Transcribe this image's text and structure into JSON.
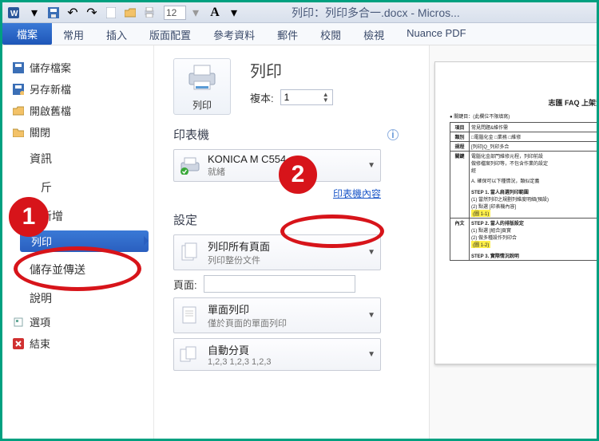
{
  "titlebar": {
    "font_size": "12",
    "title": "列印：列印多合一.docx - Micros..."
  },
  "ribbon": {
    "file_tab": "檔案",
    "tabs": [
      "常用",
      "插入",
      "版面配置",
      "參考資料",
      "郵件",
      "校閱",
      "檢視",
      "Nuance PDF"
    ]
  },
  "leftmenu": {
    "save": "儲存檔案",
    "save_as": "另存新檔",
    "open": "開啟舊檔",
    "close": "關閉",
    "info": "資訊",
    "recent_trunc": "斤",
    "new": "新增",
    "print": "列印",
    "save_send": "儲存並傳送",
    "help": "說明",
    "options": "選項",
    "exit": "結束"
  },
  "annotations": {
    "badge1": "1",
    "badge2": "2"
  },
  "print": {
    "heading": "列印",
    "print_btn": "列印",
    "copies_label": "複本:",
    "copies_value": "1",
    "printer_heading": "印表機",
    "printer_name": "KONICA M               C554",
    "printer_status": "就緒",
    "printer_props_link": "印表機內容",
    "settings_heading": "設定",
    "scope_line1": "列印所有頁面",
    "scope_line2": "列印整份文件",
    "pages_label": "頁面:",
    "side_line1": "單面列印",
    "side_line2": "僅於頁面的單面列印",
    "collate_line1": "自動分頁",
    "collate_line2": "1,2,3    1,2,3    1,2,3"
  },
  "preview": {
    "doc_title": "志匯 FAQ 上架資",
    "bullet": "關鍵目：(此欄位不限填寫)",
    "r1a": "項目",
    "r1b": "常見問題&維作需",
    "r2a": "類別",
    "r2b": "□電腦化金 □業務 □維修",
    "r3a": "規程",
    "r3b": "[列印]Q_列印多合",
    "r4a": "關鍵",
    "r4b1": "電腦化金部門維修元程，列印前設",
    "r4b2": "做修檔案列印等，不包含作業的設定",
    "r4b3": "經",
    "r4b4": "A. 確保可以下種情況，類似定義",
    "r4s1": "STEP 1. 當人肩選列印範圍",
    "r4s1a": "(1) 當然列印之規劃列維度明細(預設)",
    "r4s1b": "(2) 點選 [印表機內容]",
    "r4h1": "(圖 1-1)",
    "r5a": "內文",
    "r4s2": "STEP 2. 當人的排版設定",
    "r4s2a": "(1) 點選 [組合]頁實",
    "r4s2b": "(2) 做多種設作列印合",
    "r4h2": "(圖 1-2)",
    "r4s3": "STEP 3. 實際情況說明"
  }
}
